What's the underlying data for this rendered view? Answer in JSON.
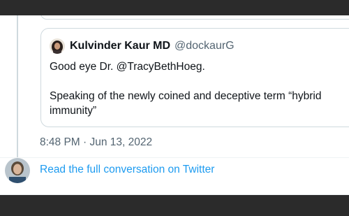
{
  "quoted_tweet": {
    "author_name": "Kulvinder Kaur MD",
    "author_handle": "@dockaurG",
    "avatar_icon": "avatar-icon",
    "text": "Good eye Dr. @TracyBethHoeg.\n\nSpeaking of the newly coined and deceptive term “hybrid immunity”"
  },
  "tweet": {
    "timestamp": "8:48 PM · Jun 13, 2022"
  },
  "footer": {
    "link_label": "Read the full conversation on Twitter",
    "link_color": "#1d9bf0"
  }
}
